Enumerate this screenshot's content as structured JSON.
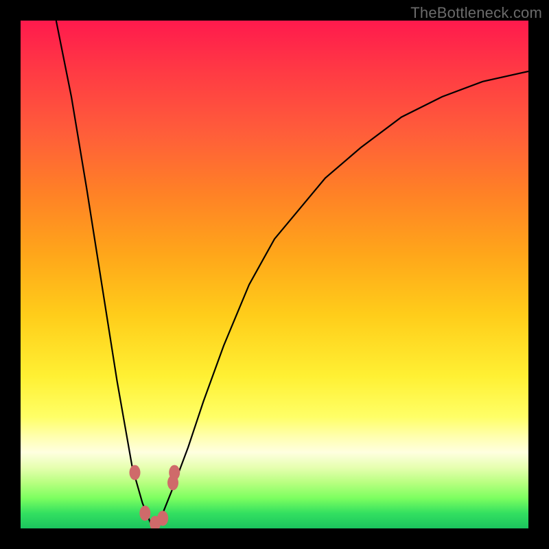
{
  "watermark": "TheBottleneck.com",
  "colors": {
    "background": "#000000",
    "curve_stroke": "#000000",
    "marker_fill": "#cf6a6a",
    "gradient": [
      "#ff1a4d",
      "#ff3a44",
      "#ff5d3a",
      "#ff8126",
      "#ffa61a",
      "#ffcd1a",
      "#fff033",
      "#ffff66",
      "#ffffb0",
      "#ffffe0",
      "#e6ffb0",
      "#b8ff80",
      "#7dff60",
      "#33e060",
      "#1bc45e"
    ]
  },
  "chart_data": {
    "type": "line",
    "title": "",
    "xlabel": "",
    "ylabel": "",
    "xlim": [
      0,
      100
    ],
    "ylim": [
      0,
      100
    ],
    "legend": false,
    "notes": "V-shaped bottleneck curve. Minimum near x≈26, y≈0. Red markers cluster near the trough and slightly up the right branch. Interpolated from pixel positions; no axis tick labels are rendered in the source image.",
    "series": [
      {
        "name": "curve",
        "x": [
          7,
          10,
          13,
          16,
          19,
          22,
          24,
          26,
          28,
          30,
          33,
          36,
          40,
          45,
          50,
          55,
          60,
          67,
          75,
          83,
          91,
          100
        ],
        "y": [
          100,
          85,
          67,
          48,
          29,
          12,
          5,
          0,
          3,
          8,
          16,
          25,
          36,
          48,
          57,
          63,
          69,
          75,
          81,
          85,
          88,
          90
        ]
      }
    ],
    "markers": [
      {
        "x": 22.5,
        "y": 11
      },
      {
        "x": 24.5,
        "y": 3
      },
      {
        "x": 26.5,
        "y": 1
      },
      {
        "x": 28.0,
        "y": 2
      },
      {
        "x": 30.0,
        "y": 9
      },
      {
        "x": 30.3,
        "y": 11
      }
    ]
  }
}
